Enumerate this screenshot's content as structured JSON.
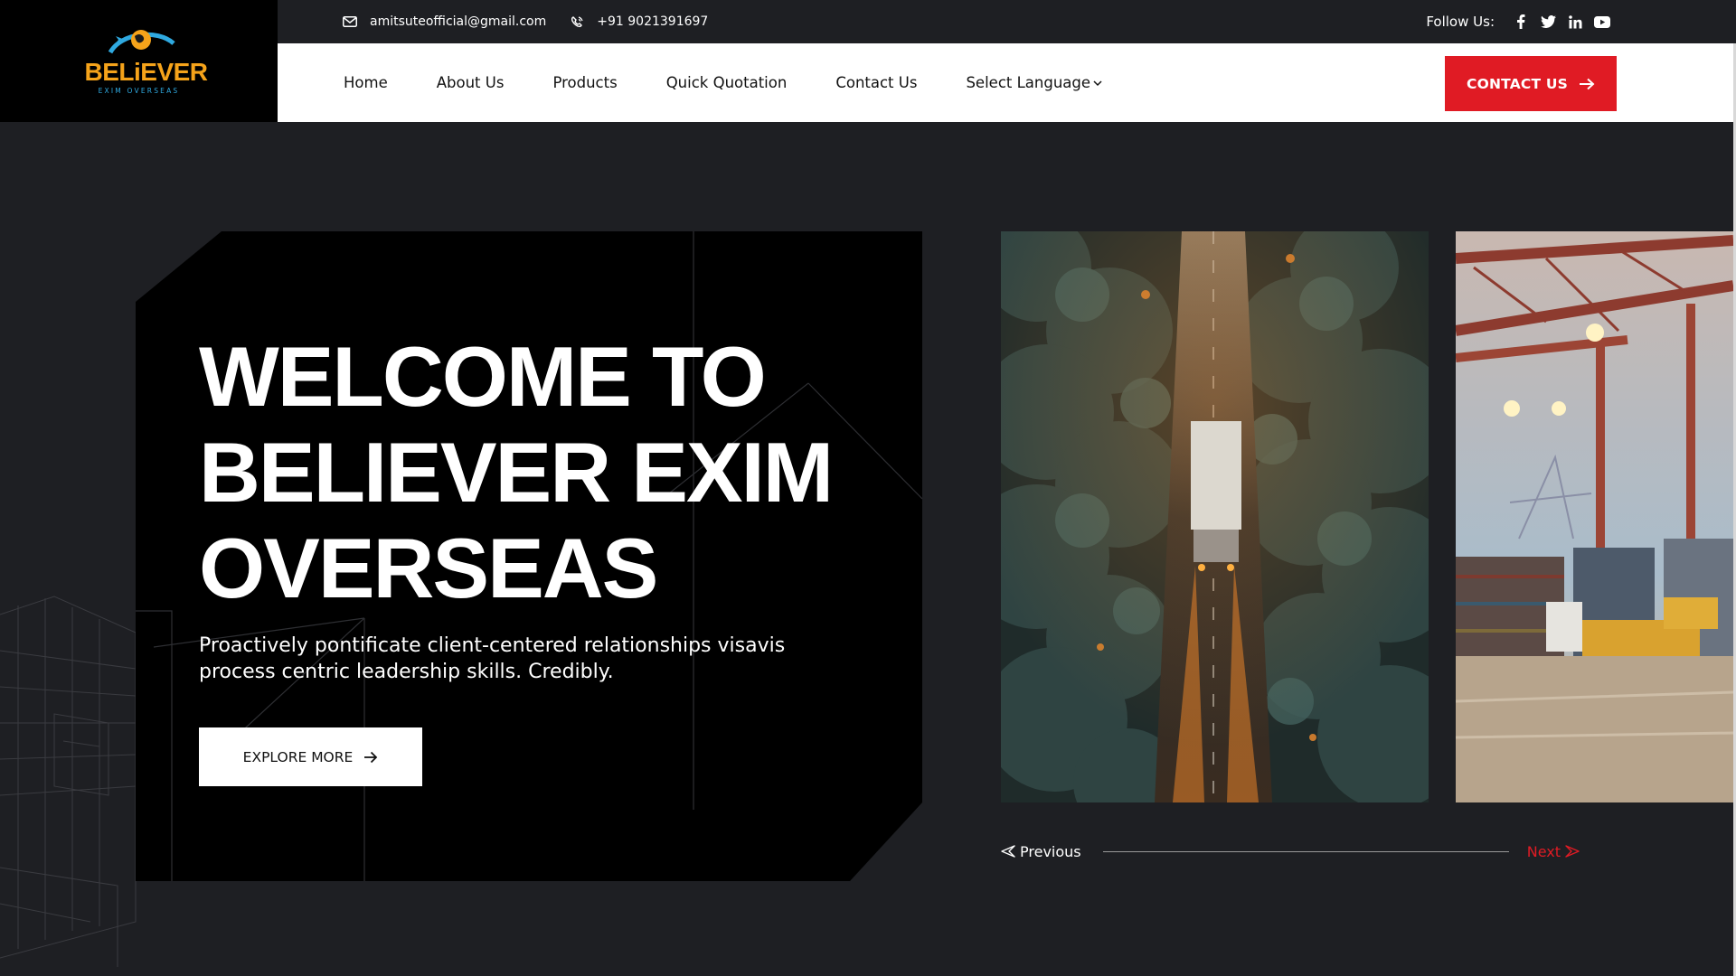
{
  "brand": {
    "logo_word": "BELiEVER",
    "logo_sub": "EXIM OVERSEAS",
    "primary": "#f5a31a",
    "secondary": "#2fa9e0"
  },
  "topbar": {
    "email": "amitsuteofficial@gmail.com",
    "email_icon": "envelope-icon",
    "phone": "+91 9021391697",
    "phone_icon": "phone-icon",
    "follow_label": "Follow Us:",
    "socials": [
      {
        "name": "facebook-icon",
        "glyph": "f"
      },
      {
        "name": "twitter-icon",
        "glyph": "t"
      },
      {
        "name": "linkedin-icon",
        "glyph": "in"
      },
      {
        "name": "youtube-icon",
        "glyph": "yt"
      }
    ]
  },
  "nav": {
    "items": [
      "Home",
      "About Us",
      "Products",
      "Quick Quotation",
      "Contact Us"
    ],
    "language": "Select Language",
    "cta": "CONTACT US"
  },
  "hero": {
    "title_lines": [
      "WELCOME TO",
      "BELIEVER EXIM",
      "OVERSEAS"
    ],
    "subtitle": "Proactively pontificate client-centered relationships visavis process centric leadership skills. Credibly.",
    "button": "EXPLORE MORE"
  },
  "slider": {
    "previous": "Previous",
    "next": "Next",
    "slides": [
      "truck-on-forest-road-image",
      "container-port-cranes-image"
    ]
  },
  "colors": {
    "accent": "#e01b24",
    "background": "#1e1f23",
    "card": "#000000"
  }
}
